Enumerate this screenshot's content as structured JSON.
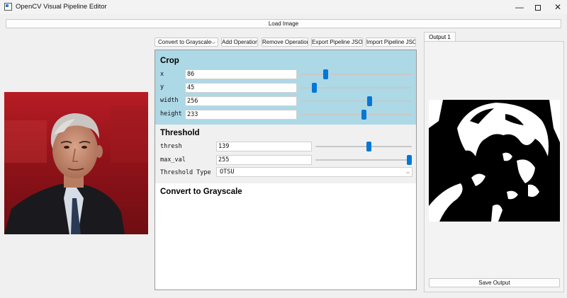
{
  "window": {
    "title": "OpenCV Visual Pipeline Editor",
    "minimize_glyph": "—",
    "close_glyph": "✕"
  },
  "toolbar": {
    "load_image_label": "Load Image",
    "operation_select": {
      "selected": "Convert to Grayscale"
    },
    "add_label": "Add Operation",
    "remove_label": "Remove Operation",
    "export_label": "Export Pipeline JSON",
    "import_label": "Import Pipeline JSON"
  },
  "pipeline": {
    "operations": [
      {
        "title": "Crop",
        "params": [
          {
            "label": "x",
            "value": "86",
            "level": 0.22
          },
          {
            "label": "y",
            "value": "45",
            "level": 0.12
          },
          {
            "label": "width",
            "value": "256",
            "level": 0.62
          },
          {
            "label": "height",
            "value": "233",
            "level": 0.57
          }
        ]
      },
      {
        "title": "Threshold",
        "params": [
          {
            "label": "thresh",
            "value": "139",
            "level": 0.55
          },
          {
            "label": "max_val",
            "value": "255",
            "level": 1.0
          }
        ],
        "select": {
          "label": "Threshold Type",
          "selected": "OTSU"
        }
      },
      {
        "title": "Convert to Grayscale"
      }
    ]
  },
  "output": {
    "tab_label": "Output 1",
    "save_label": "Save Output"
  },
  "colors": {
    "crop_panel_bg": "#add8e6",
    "slider_accent": "#0078d7"
  },
  "icons": {
    "app": "opencv-window-icon",
    "combo_arrow": "chevron-down-icon"
  }
}
